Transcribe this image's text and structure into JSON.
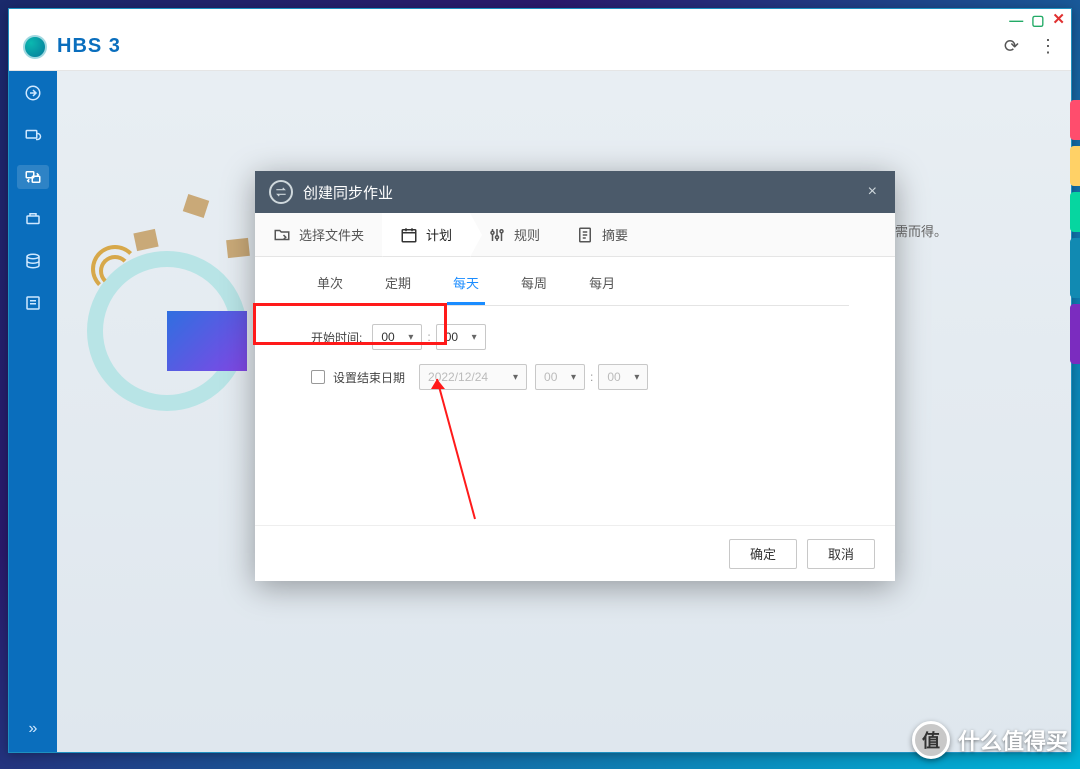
{
  "app": {
    "title": "HBS 3",
    "logo_abbr": "HBS"
  },
  "background_hint_text": "，数据访问应需而得。",
  "sidebar": {
    "items": [
      {
        "name": "overview"
      },
      {
        "name": "backup"
      },
      {
        "name": "sync",
        "active": true
      },
      {
        "name": "restore"
      },
      {
        "name": "storage"
      },
      {
        "name": "logs"
      }
    ]
  },
  "modal": {
    "title": "创建同步作业",
    "close_glyph": "×",
    "steps": [
      {
        "id": "select-folder",
        "label": "选择文件夹",
        "active": false
      },
      {
        "id": "schedule",
        "label": "计划",
        "active": true
      },
      {
        "id": "rules",
        "label": "规则",
        "active": false
      },
      {
        "id": "summary",
        "label": "摘要",
        "active": false
      }
    ],
    "schedule_tabs": [
      {
        "id": "once",
        "label": "单次",
        "active": false
      },
      {
        "id": "periodic",
        "label": "定期",
        "active": false
      },
      {
        "id": "daily",
        "label": "每天",
        "active": true
      },
      {
        "id": "weekly",
        "label": "每周",
        "active": false
      },
      {
        "id": "monthly",
        "label": "每月",
        "active": false
      }
    ],
    "start_time_label": "开始时间:",
    "start_hour": "00",
    "start_minute": "00",
    "end_date_label": "设置结束日期",
    "end_date_checked": false,
    "end_date_value": "2022/12/24",
    "end_hour": "00",
    "end_minute": "00",
    "buttons": {
      "ok": "确定",
      "cancel": "取消"
    }
  },
  "watermark": {
    "badge_glyph": "值",
    "text": "什么值得买"
  }
}
